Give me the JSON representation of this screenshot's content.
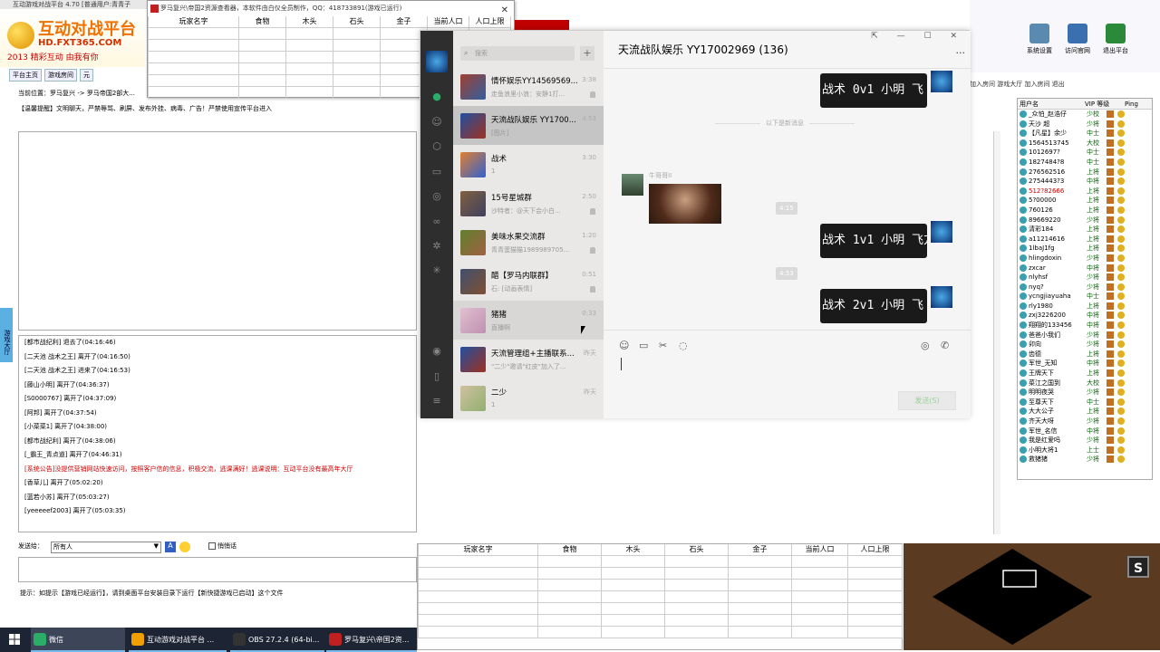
{
  "bg_window": {
    "title": "互动游戏对战平台 4.70 [普通用户:青青子",
    "logo_line1": "互动对战平台",
    "logo_line2": "HD.FXT365.COM",
    "logo_line3": "2013 精彩互动 由我有你",
    "tabs": [
      "平台主页",
      "游戏房间",
      "元"
    ],
    "location": "当前位置：罗马复兴 -> 罗马帝国2部大...",
    "notice": "【温馨提醒】文明聊天，严禁辱骂、刷屏、发布外挂、病毒、广告！严禁使用宣传平台进入",
    "side_label": "游戏大厅",
    "log": [
      {
        "text": "[都市战纪利] 退去了(04:16:46)",
        "red": false
      },
      {
        "text": "[二天池 战术之王] 离开了(04:16:50)",
        "red": false
      },
      {
        "text": "[二天池 战术之王] 进来了(04:16:53)",
        "red": false
      },
      {
        "text": "[藤山小明] 离开了(04:36:37)",
        "red": false
      },
      {
        "text": "[S0000767] 离开了(04:37:09)",
        "red": false
      },
      {
        "text": "[阿邦] 离开了(04:37:54)",
        "red": false
      },
      {
        "text": "[小菜菜1] 离开了(04:38:00)",
        "red": false
      },
      {
        "text": "[都市战纪利] 离开了(04:38:06)",
        "red": false
      },
      {
        "text": "[_霸王_青点道] 离开了(04:46:31)",
        "red": false
      },
      {
        "text": "[系统公告]没提供营销网站快速访问，按照客户信的信息，积极交流，逃课满好！逃课说明：互动平台没有最高年大厅",
        "red": true
      },
      {
        "text": "[香草儿] 离开了(05:02:20)",
        "red": false
      },
      {
        "text": "[蓝若小苏] 离开了(05:03:27)",
        "red": false
      },
      {
        "text": "[yeeeeef2003] 离开了(05:03:35)",
        "red": false
      }
    ],
    "send_to_label": "发送给：",
    "send_to_value": "所有人",
    "private_label": "悄悄话",
    "hint": "提示：如提示【游戏已经运行】，请到桌面平台安装目录下运行【新快捷游戏已启动】这个文件"
  },
  "small_window": {
    "title": "罗马复兴\\帝国2资源查看器，本软件由白仪全员制作，QQ：418733891(游戏已运行)",
    "headers": [
      "玩家名字",
      "食物",
      "木头",
      "石头",
      "金子",
      "当前人口",
      "人口上限"
    ]
  },
  "desktop": {
    "icons": [
      {
        "label": "系统设置",
        "color": "#5a8ab0"
      },
      {
        "label": "访问官网",
        "color": "#3a70b0"
      },
      {
        "label": "退出平台",
        "color": "#2a8a3a"
      }
    ],
    "toolbar_text": "加入房间  游戏大厅  加入房间  退出",
    "user_headers": [
      "用户名",
      "VIP 等级",
      "Ping"
    ],
    "users": [
      {
        "name": "_众怕_赵浩仔",
        "level": "少校"
      },
      {
        "name": "天沙 超",
        "level": "少将"
      },
      {
        "name": "【凡星】余少",
        "level": "中士"
      },
      {
        "name": "1564513745",
        "level": "大校"
      },
      {
        "name": "1012697?",
        "level": "中士"
      },
      {
        "name": "1827484?8",
        "level": "中士"
      },
      {
        "name": "276562516",
        "level": "上将"
      },
      {
        "name": "2754443?3",
        "level": "中将"
      },
      {
        "name": "512?82666",
        "level": "上将"
      },
      {
        "name": "5?00000",
        "level": "上将"
      },
      {
        "name": "760126",
        "level": "上将"
      },
      {
        "name": "89669220",
        "level": "少将"
      },
      {
        "name": "清彩184",
        "level": "上将"
      },
      {
        "name": "a11214616",
        "level": "上将"
      },
      {
        "name": "1lbaJ1fg",
        "level": "上将"
      },
      {
        "name": "hlingdoxin",
        "level": "少将"
      },
      {
        "name": "zxcar",
        "level": "中将"
      },
      {
        "name": "nlyhsf",
        "level": "少将"
      },
      {
        "name": "nyq?",
        "level": "少将"
      },
      {
        "name": "ycngjiayuaha",
        "level": "中士"
      },
      {
        "name": "rly1980",
        "level": "上将"
      },
      {
        "name": "zxj3226200",
        "level": "中将"
      },
      {
        "name": "翔翔的133456",
        "level": "中将"
      },
      {
        "name": "爸爸小我们",
        "level": "少将"
      },
      {
        "name": "卯向",
        "level": "少将"
      },
      {
        "name": "齿德",
        "level": "上将"
      },
      {
        "name": "军世_无知",
        "level": "中将"
      },
      {
        "name": "王牌天下",
        "level": "上将"
      },
      {
        "name": "菜江之国到",
        "level": "大校"
      },
      {
        "name": "明明夜哭",
        "level": "少将"
      },
      {
        "name": "至尊天下",
        "level": "中士"
      },
      {
        "name": "大大公子",
        "level": "上将"
      },
      {
        "name": "齐天大呀",
        "level": "少将"
      },
      {
        "name": "军世_名信",
        "level": "中将"
      },
      {
        "name": "我是红爱吗",
        "level": "少将"
      },
      {
        "name": "小明大将1",
        "level": "上士"
      },
      {
        "name": "救猪猪",
        "level": "少将"
      }
    ]
  },
  "bottom_sheet": {
    "headers": [
      "玩家名字",
      "食物",
      "木头",
      "石头",
      "金子",
      "当前人口",
      "人口上限"
    ]
  },
  "game_thumb": {
    "button": "S"
  },
  "taskbar": {
    "items": [
      {
        "label": "微信",
        "color": "#2aae67"
      },
      {
        "label": "互动游戏对战平台 ...",
        "color": "#f0a000"
      },
      {
        "label": "OBS 27.2.4 (64-bi...",
        "color": "#333333"
      },
      {
        "label": "罗马复兴\\帝国2资...",
        "color": "#c02020"
      }
    ]
  },
  "wechat": {
    "search_placeholder": "搜索",
    "plus": "+",
    "conversations": [
      {
        "name": "情怀娱乐YY14569569...",
        "preview": "走鱼浪里小浪：安静1打...",
        "time": "3:38",
        "muted": true,
        "colors": [
          "#a04030",
          "#3060a0"
        ]
      },
      {
        "name": "天流战队娱乐 YY1700...",
        "preview": "[图片]",
        "time": "4:53",
        "muted": false,
        "colors": [
          "#2050a0",
          "#a03020"
        ]
      },
      {
        "name": "战术",
        "preview": "1",
        "time": "3:30",
        "muted": false,
        "colors": [
          "#e08030",
          "#3060d0"
        ]
      },
      {
        "name": "15号星城群",
        "preview": "沙特者：@天下会小白...",
        "time": "2:50",
        "muted": true,
        "colors": [
          "#806040",
          "#404060"
        ]
      },
      {
        "name": "美味水果交流群",
        "preview": "青青蛋猫猫1989989705...",
        "time": "1:20",
        "muted": true,
        "colors": [
          "#608030",
          "#a06040"
        ]
      },
      {
        "name": "醋【罗马内联群】",
        "preview": "石: [动画表情]",
        "time": "0:51",
        "muted": true,
        "colors": [
          "#405070",
          "#805030"
        ]
      },
      {
        "name": "猪猪",
        "preview": "直播啊",
        "time": "0:33",
        "muted": false,
        "colors": [
          "#e0c0d0",
          "#c090b0"
        ]
      },
      {
        "name": "天流管理组+主播联系...",
        "preview": "\"二少\"邀请\"红皮\"加入了...",
        "time": "昨天",
        "muted": false,
        "colors": [
          "#2050a0",
          "#a03020"
        ]
      },
      {
        "name": "二少",
        "preview": "1",
        "time": "昨天",
        "muted": false,
        "colors": [
          "#d0c0a0",
          "#90b070"
        ]
      }
    ],
    "chat_title": "天流战队娱乐 YY17002969 (136)",
    "window_controls": "⇱ — ☐ ✕",
    "more": "···",
    "new_msg_divider": "以下是新消息",
    "other_name": "牛哥哥II",
    "messages": [
      {
        "text": "战术 0v1 小明 飞",
        "time": ""
      },
      {
        "text": "战术 1v1 小明 飞方",
        "time": "4:15"
      },
      {
        "text": "战术 2v1 小明 飞",
        "time": "4:53"
      }
    ],
    "send_label": "发送(S)",
    "side_icons": [
      "chat-icon",
      "contacts-icon",
      "box-icon",
      "folder-icon",
      "moments-icon",
      "miniprogram-icon",
      "settings-icon",
      "sparkle-icon"
    ]
  }
}
